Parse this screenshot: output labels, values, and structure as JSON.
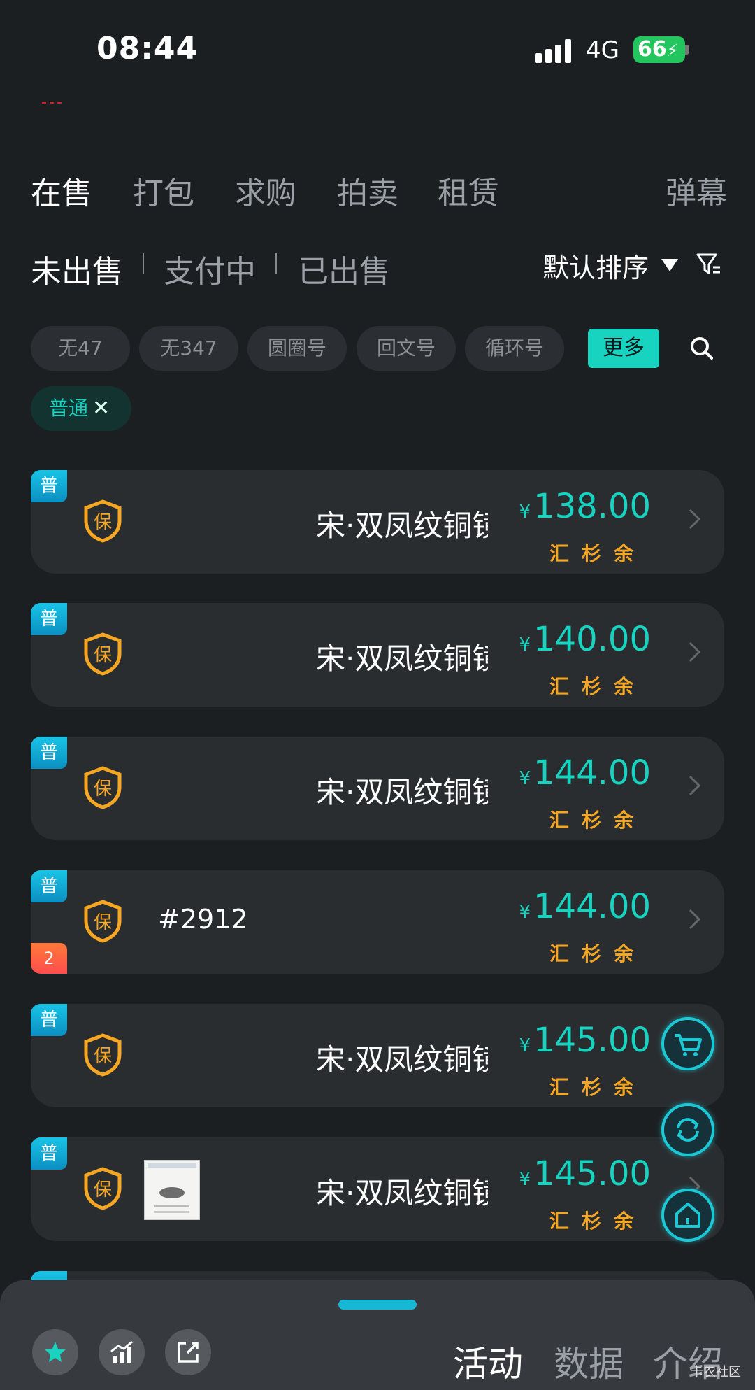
{
  "status_bar": {
    "time": "08:44",
    "network": "4G",
    "battery": "66"
  },
  "top_tabs": [
    "在售",
    "打包",
    "求购",
    "拍卖",
    "租赁"
  ],
  "danmu_label": "弹幕",
  "sub_tabs": [
    "未出售",
    "支付中",
    "已出售"
  ],
  "sort_label": "默认排序",
  "filter_chips": [
    "无47",
    "无347",
    "圆圈号",
    "回文号",
    "循环号"
  ],
  "more_label": "更多",
  "active_tag": {
    "label": "普通",
    "close": "✕"
  },
  "listings": [
    {
      "badge": "普",
      "shield": "保",
      "name": "宋·双凤纹铜镜",
      "currency": "¥",
      "price": "138.00",
      "sub": "汇杉余"
    },
    {
      "badge": "普",
      "shield": "保",
      "name": "宋·双凤纹铜镜",
      "currency": "¥",
      "price": "140.00",
      "sub": "汇杉余"
    },
    {
      "badge": "普",
      "shield": "保",
      "name": "宋·双凤纹铜镜",
      "currency": "¥",
      "price": "144.00",
      "sub": "汇杉余"
    },
    {
      "badge": "普",
      "shield": "保",
      "code": "#2912",
      "count_badge": "2",
      "currency": "¥",
      "price": "144.00",
      "sub": "汇杉余"
    },
    {
      "badge": "普",
      "shield": "保",
      "name": "宋·双凤纹铜镜",
      "currency": "¥",
      "price": "145.00",
      "sub": "汇杉余"
    },
    {
      "badge": "普",
      "shield": "保",
      "name": "宋·双凤纹铜镜",
      "currency": "¥",
      "price": "145.00",
      "sub": "汇杉余"
    }
  ],
  "bottom_tabs": [
    "活动",
    "数据",
    "介绍"
  ],
  "watermark": "卡农社区",
  "colors": {
    "accent": "#17d3c0",
    "gold": "#f5a623",
    "background": "#1c1f22",
    "card": "#2a2d30"
  },
  "icons": [
    "signal-icon",
    "battery-icon",
    "filter-icon",
    "search-icon",
    "shield-icon",
    "chevron-right-icon",
    "cart-icon",
    "refresh-icon",
    "home-icon",
    "star-icon",
    "chart-icon",
    "share-icon"
  ]
}
